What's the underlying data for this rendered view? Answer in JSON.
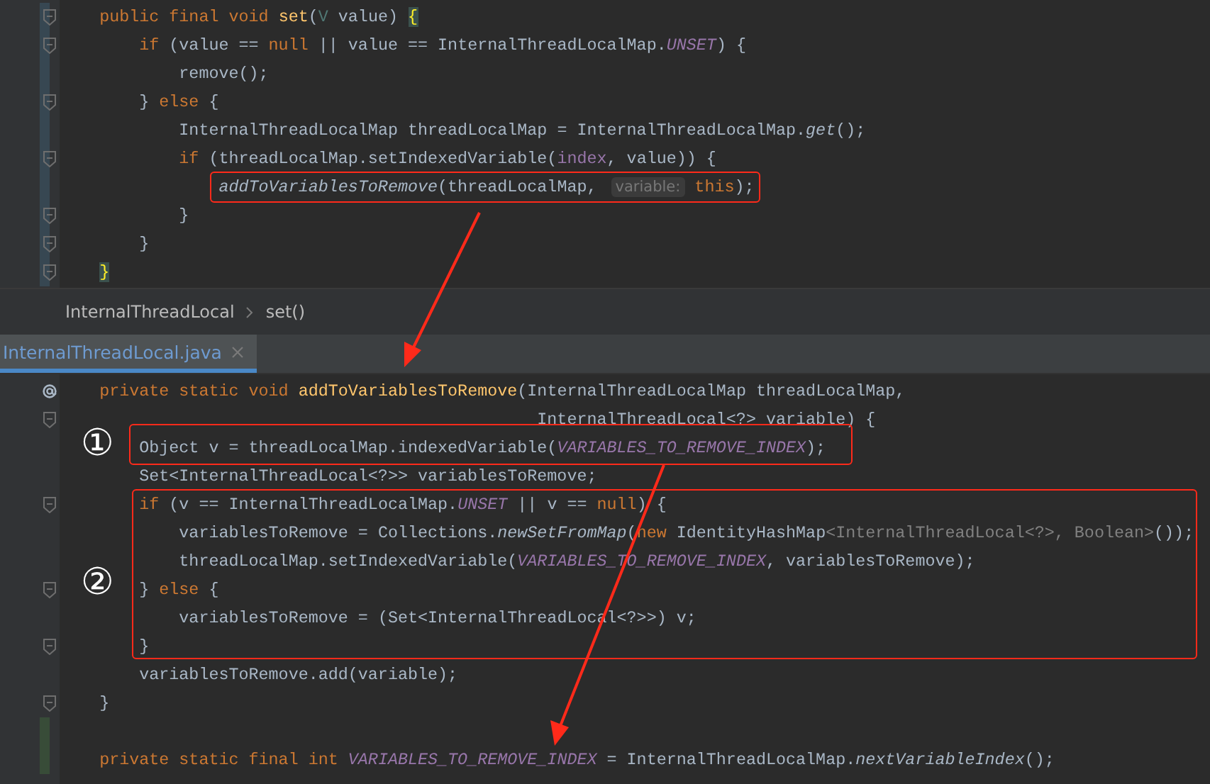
{
  "top_editor": {
    "lines": [
      {
        "fold": true,
        "changed": true,
        "tokens": [
          {
            "kind": "kw",
            "text": "    public final void "
          },
          {
            "kind": "decl",
            "text": "set"
          },
          {
            "kind": "plain",
            "text": "("
          },
          {
            "kind": "typeparam",
            "text": "V"
          },
          {
            "kind": "plain",
            "text": " value) "
          },
          {
            "kind": "brace",
            "text": "{"
          }
        ]
      },
      {
        "fold": true,
        "changed": true,
        "tokens": [
          {
            "kind": "kw",
            "text": "        if"
          },
          {
            "kind": "plain",
            "text": " (value == "
          },
          {
            "kind": "kw",
            "text": "null"
          },
          {
            "kind": "plain",
            "text": " || value == InternalThreadLocalMap."
          },
          {
            "kind": "const",
            "text": "UNSET"
          },
          {
            "kind": "plain",
            "text": ") {"
          }
        ]
      },
      {
        "fold": false,
        "changed": true,
        "tokens": [
          {
            "kind": "plain",
            "text": "            remove();"
          }
        ]
      },
      {
        "fold": true,
        "changed": true,
        "tokens": [
          {
            "kind": "plain",
            "text": "        } "
          },
          {
            "kind": "kw",
            "text": "else"
          },
          {
            "kind": "plain",
            "text": " {"
          }
        ]
      },
      {
        "fold": false,
        "changed": true,
        "tokens": [
          {
            "kind": "plain",
            "text": "            InternalThreadLocalMap threadLocalMap = InternalThreadLocalMap."
          },
          {
            "kind": "static",
            "text": "get"
          },
          {
            "kind": "plain",
            "text": "();"
          }
        ]
      },
      {
        "fold": true,
        "changed": true,
        "tokens": [
          {
            "kind": "kw",
            "text": "            if"
          },
          {
            "kind": "plain",
            "text": " (threadLocalMap.setIndexedVariable("
          },
          {
            "kind": "field",
            "text": "index"
          },
          {
            "kind": "plain",
            "text": ", value)) {"
          }
        ]
      },
      {
        "fold": false,
        "changed": true,
        "tokens": [
          {
            "kind": "static",
            "text": "                addToVariablesToRemove"
          },
          {
            "kind": "plain",
            "text": "(threadLocalMap, "
          },
          {
            "kind": "hint",
            "text": "variable:"
          },
          {
            "kind": "kw",
            "text": " this"
          },
          {
            "kind": "plain",
            "text": ");"
          }
        ]
      },
      {
        "fold": true,
        "changed": true,
        "tokens": [
          {
            "kind": "plain",
            "text": "            }"
          }
        ]
      },
      {
        "fold": true,
        "changed": true,
        "tokens": [
          {
            "kind": "plain",
            "text": "        }"
          }
        ]
      },
      {
        "fold": true,
        "changed": true,
        "tokens": [
          {
            "kind": "brace",
            "text": "    }"
          }
        ]
      }
    ]
  },
  "breadcrumbs": [
    "InternalThreadLocal",
    "set()"
  ],
  "tabs": [
    {
      "label": "InternalThreadLocal.java",
      "selected": true
    }
  ],
  "bottom_editor": {
    "lines": [
      {
        "override": true,
        "fold": false,
        "changed": false,
        "tokens": [
          {
            "kind": "kw",
            "text": "    private static void "
          },
          {
            "kind": "decl",
            "text": "addToVariablesToRemove"
          },
          {
            "kind": "plain",
            "text": "(InternalThreadLocalMap threadLocalMap,"
          }
        ]
      },
      {
        "override": false,
        "fold": true,
        "changed": false,
        "tokens": [
          {
            "kind": "plain",
            "text": "                                                InternalThreadLocal<?> variable) {"
          }
        ]
      },
      {
        "override": false,
        "fold": false,
        "changed": false,
        "tokens": [
          {
            "kind": "plain",
            "text": "        Object v = threadLocalMap.indexedVariable("
          },
          {
            "kind": "const",
            "text": "VARIABLES_TO_REMOVE_INDEX"
          },
          {
            "kind": "plain",
            "text": ");"
          }
        ]
      },
      {
        "override": false,
        "fold": false,
        "changed": false,
        "tokens": [
          {
            "kind": "plain",
            "text": "        Set<InternalThreadLocal<?>> variablesToRemove;"
          }
        ]
      },
      {
        "override": false,
        "fold": true,
        "changed": false,
        "tokens": [
          {
            "kind": "kw",
            "text": "        if"
          },
          {
            "kind": "plain",
            "text": " (v == InternalThreadLocalMap."
          },
          {
            "kind": "const",
            "text": "UNSET"
          },
          {
            "kind": "plain",
            "text": " || v == "
          },
          {
            "kind": "kw",
            "text": "null"
          },
          {
            "kind": "plain",
            "text": ") {"
          }
        ]
      },
      {
        "override": false,
        "fold": false,
        "changed": false,
        "tokens": [
          {
            "kind": "plain",
            "text": "            variablesToRemove = Collections."
          },
          {
            "kind": "static",
            "text": "newSetFromMap"
          },
          {
            "kind": "plain",
            "text": "("
          },
          {
            "kind": "kw",
            "text": "new"
          },
          {
            "kind": "plain",
            "text": " IdentityHashMap"
          },
          {
            "kind": "gray",
            "text": "<InternalThreadLocal<?>, Boolean>"
          },
          {
            "kind": "plain",
            "text": "());"
          }
        ]
      },
      {
        "override": false,
        "fold": false,
        "changed": false,
        "tokens": [
          {
            "kind": "plain",
            "text": "            threadLocalMap.setIndexedVariable("
          },
          {
            "kind": "const",
            "text": "VARIABLES_TO_REMOVE_INDEX"
          },
          {
            "kind": "plain",
            "text": ", variablesToRemove);"
          }
        ]
      },
      {
        "override": false,
        "fold": true,
        "changed": false,
        "tokens": [
          {
            "kind": "plain",
            "text": "        } "
          },
          {
            "kind": "kw",
            "text": "else"
          },
          {
            "kind": "plain",
            "text": " {"
          }
        ]
      },
      {
        "override": false,
        "fold": false,
        "changed": false,
        "tokens": [
          {
            "kind": "plain",
            "text": "            variablesToRemove = (Set<InternalThreadLocal<?>>) v;"
          }
        ]
      },
      {
        "override": false,
        "fold": true,
        "changed": false,
        "tokens": [
          {
            "kind": "plain",
            "text": "        }"
          }
        ]
      },
      {
        "override": false,
        "fold": false,
        "changed": false,
        "tokens": [
          {
            "kind": "plain",
            "text": "        variablesToRemove.add(variable);"
          }
        ]
      },
      {
        "override": false,
        "fold": true,
        "changed": false,
        "tokens": [
          {
            "kind": "plain",
            "text": "    }"
          }
        ]
      },
      {
        "override": false,
        "fold": false,
        "changed": true
      },
      {
        "override": false,
        "fold": false,
        "changed": true,
        "tokens": [
          {
            "kind": "kw",
            "text": "    private static final int "
          },
          {
            "kind": "const",
            "text": "VARIABLES_TO_REMOVE_INDEX"
          },
          {
            "kind": "plain",
            "text": " = InternalThreadLocalMap."
          },
          {
            "kind": "static",
            "text": "nextVariableIndex"
          },
          {
            "kind": "plain",
            "text": "();"
          }
        ]
      }
    ]
  },
  "annotations": [
    {
      "kind": "marker",
      "label": "①"
    },
    {
      "kind": "marker",
      "label": "②"
    }
  ]
}
